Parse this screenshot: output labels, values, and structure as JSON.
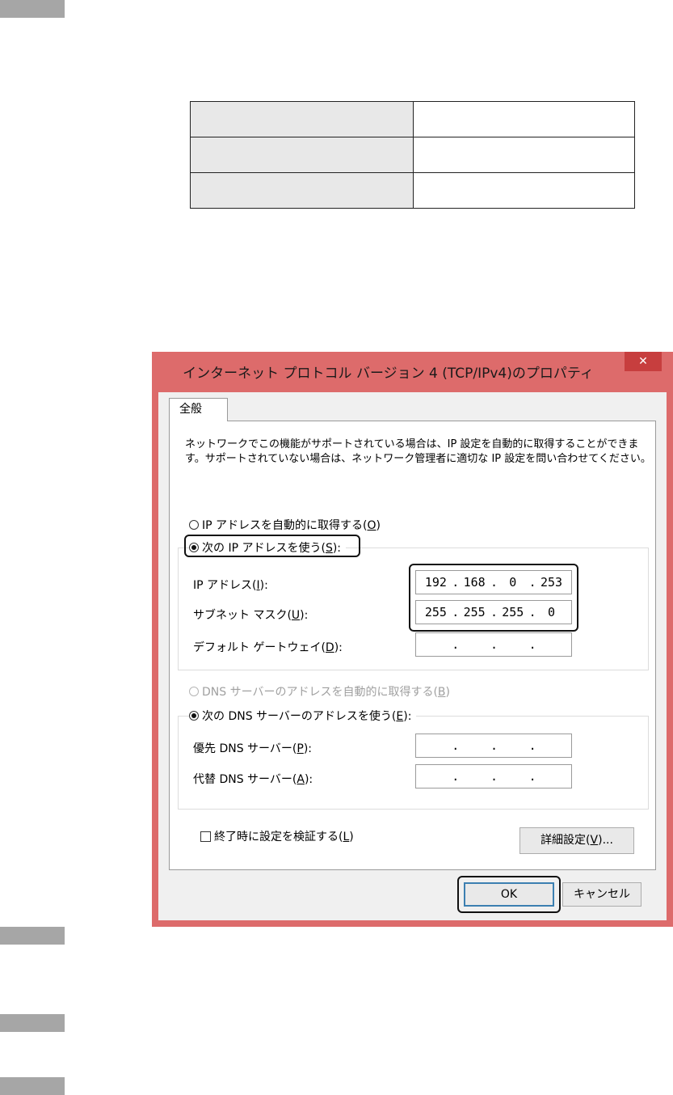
{
  "settings_table": {
    "rows": [
      {
        "key": "",
        "value": ""
      },
      {
        "key": "",
        "value": ""
      },
      {
        "key": "",
        "value": ""
      }
    ]
  },
  "dialog": {
    "title": "インターネット プロトコル バージョン 4 (TCP/IPv4)のプロパティ",
    "close_label": "✕",
    "tab_general": "全般",
    "description": "ネットワークでこの機能がサポートされている場合は、IP 設定を自動的に取得することができます。サポートされていない場合は、ネットワーク管理者に適切な IP 設定を問い合わせてください。",
    "radio_auto_ip": {
      "label": "IP アドレスを自動的に取得する(",
      "key": "O",
      "suffix": ")",
      "checked": false
    },
    "radio_manual_ip": {
      "label": "次の IP アドレスを使う(",
      "key": "S",
      "suffix": "):",
      "checked": true
    },
    "ip_address": {
      "label": "IP アドレス(",
      "key": "I",
      "suffix": "):",
      "octets": [
        "192",
        "168",
        "0",
        "253"
      ]
    },
    "subnet_mask": {
      "label": "サブネット マスク(",
      "key": "U",
      "suffix": "):",
      "octets": [
        "255",
        "255",
        "255",
        "0"
      ]
    },
    "default_gateway": {
      "label": "デフォルト ゲートウェイ(",
      "key": "D",
      "suffix": "):",
      "octets": [
        "",
        "",
        "",
        ""
      ]
    },
    "radio_auto_dns": {
      "label": "DNS サーバーのアドレスを自動的に取得する(",
      "key": "B",
      "suffix": ")",
      "checked": false,
      "disabled": true
    },
    "radio_manual_dns": {
      "label": "次の DNS サーバーのアドレスを使う(",
      "key": "E",
      "suffix": "):",
      "checked": true
    },
    "preferred_dns": {
      "label": "優先 DNS サーバー(",
      "key": "P",
      "suffix": "):",
      "octets": [
        "",
        "",
        "",
        ""
      ]
    },
    "alternate_dns": {
      "label": "代替 DNS サーバー(",
      "key": "A",
      "suffix": "):",
      "octets": [
        "",
        "",
        "",
        ""
      ]
    },
    "validate_checkbox": {
      "label": "終了時に設定を検証する(",
      "key": "L",
      "suffix": ")",
      "checked": false
    },
    "advanced_button": {
      "label": "詳細設定(",
      "key": "V",
      "suffix": ")..."
    },
    "ok_button": "OK",
    "cancel_button": "キャンセル"
  },
  "colors": {
    "title_bar": "#dd6b6b",
    "close_button": "#c73e3e",
    "step_bar": "#a6a6a6",
    "table_key_bg": "#e8e8e8"
  }
}
